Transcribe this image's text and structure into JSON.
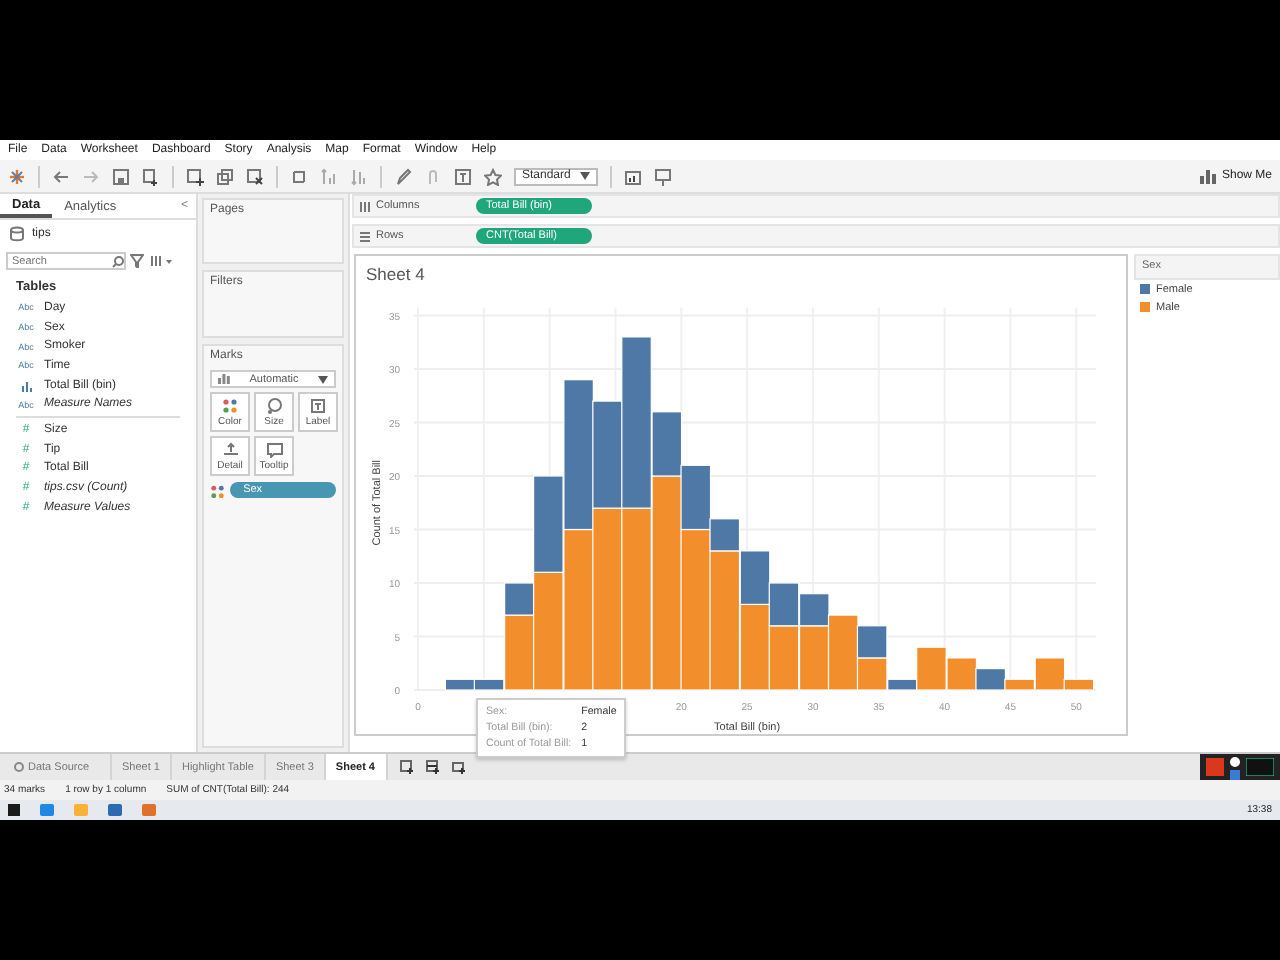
{
  "menu": [
    "File",
    "Data",
    "Worksheet",
    "Dashboard",
    "Story",
    "Analysis",
    "Map",
    "Format",
    "Window",
    "Help"
  ],
  "toolbar": {
    "fit": "Standard",
    "show_me": "Show Me"
  },
  "data_pane": {
    "tabs": [
      {
        "label": "Data",
        "selected": true
      },
      {
        "label": "Analytics",
        "selected": false
      }
    ],
    "collapse": "<",
    "source": "tips",
    "search": {
      "placeholder": "Search"
    },
    "section": "Tables",
    "fields": [
      {
        "kind": "dimension",
        "icon": "Abc",
        "name": "Day",
        "generated": false
      },
      {
        "kind": "dimension",
        "icon": "Abc",
        "name": "Sex",
        "generated": false
      },
      {
        "kind": "dimension",
        "icon": "Abc",
        "name": "Smoker",
        "generated": false
      },
      {
        "kind": "dimension",
        "icon": "Abc",
        "name": "Time",
        "generated": false
      },
      {
        "kind": "bin",
        "name": "Total Bill (bin)",
        "generated": false
      },
      {
        "kind": "dimension",
        "icon": "Abc",
        "name": "Measure Names",
        "generated": true
      },
      {
        "kind": "measure",
        "icon": "#",
        "name": "Size",
        "generated": false
      },
      {
        "kind": "measure",
        "icon": "#",
        "name": "Tip",
        "generated": false
      },
      {
        "kind": "measure",
        "icon": "#",
        "name": "Total Bill",
        "generated": false
      },
      {
        "kind": "measure",
        "icon": "#",
        "name": "tips.csv (Count)",
        "generated": true
      },
      {
        "kind": "measure",
        "icon": "#",
        "name": "Measure Values",
        "generated": true
      }
    ]
  },
  "pages": {
    "title": "Pages"
  },
  "filters": {
    "title": "Filters"
  },
  "marks": {
    "title": "Marks",
    "mark_type": "Automatic",
    "buttons": [
      {
        "kind": "color",
        "label": "Color"
      },
      {
        "kind": "size",
        "label": "Size"
      },
      {
        "kind": "label",
        "label": "Label"
      },
      {
        "kind": "detail",
        "label": "Detail"
      },
      {
        "kind": "tooltip",
        "label": "Tooltip"
      }
    ],
    "pill": "Sex"
  },
  "columns": {
    "label": "Columns",
    "pill": "Total Bill (bin)"
  },
  "rows": {
    "label": "Rows",
    "pill": "CNT(Total Bill)"
  },
  "sheet": {
    "title": "Sheet 4",
    "chart_data": {
      "type": "bar",
      "stacked": true,
      "xlabel": "Total Bill (bin)",
      "ylabel": "Count of Total Bill",
      "x": [
        3.2,
        5.4,
        7.7,
        9.9,
        12.2,
        14.4,
        16.6,
        18.9,
        21.1,
        23.3,
        25.6,
        27.8,
        30.1,
        32.3,
        34.5,
        36.8,
        39.0,
        41.3,
        43.5,
        45.7,
        48.0,
        50.2
      ],
      "series": [
        {
          "name": "Male",
          "color": "#f28e2b",
          "values": [
            0,
            0,
            7,
            11,
            15,
            17,
            17,
            20,
            15,
            13,
            8,
            6,
            6,
            7,
            3,
            0,
            4,
            3,
            0,
            1,
            3,
            1
          ]
        },
        {
          "name": "Female",
          "color": "#4e79a7",
          "values": [
            1,
            1,
            3,
            9,
            14,
            10,
            16,
            6,
            6,
            3,
            5,
            4,
            3,
            0,
            3,
            1,
            0,
            0,
            2,
            0,
            0,
            0
          ]
        }
      ],
      "xlim": [
        0,
        51.5
      ],
      "ylim": [
        0,
        35
      ],
      "grid": true,
      "xticks": [
        0,
        20,
        25,
        30,
        35,
        40,
        45,
        50
      ],
      "yticks": [
        0,
        5,
        10,
        15,
        20,
        25,
        30,
        35
      ]
    },
    "tooltip": [
      {
        "label": "Sex:",
        "value": "Female"
      },
      {
        "label": "Total Bill (bin):",
        "value": "2"
      },
      {
        "label": "Count of Total Bill:",
        "value": "1"
      }
    ]
  },
  "legend": {
    "title": "Sex"
  },
  "sheet_tabs": [
    {
      "kind": "datasource",
      "label": "Data Source",
      "selected": false
    },
    {
      "kind": "sheet",
      "label": "Sheet 1",
      "selected": false
    },
    {
      "kind": "sheet",
      "label": "Highlight Table",
      "selected": false
    },
    {
      "kind": "sheet",
      "label": "Sheet 3",
      "selected": false
    },
    {
      "kind": "sheet",
      "label": "Sheet 4",
      "selected": true
    }
  ],
  "status": [
    "34 marks",
    "1 row by 1 column",
    "SUM of CNT(Total Bill): 244"
  ],
  "taskbar": {
    "time": "13:38"
  }
}
